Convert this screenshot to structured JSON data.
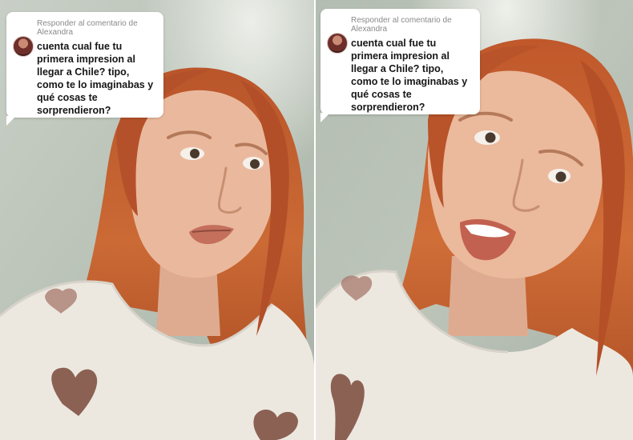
{
  "panels": [
    {
      "reply_label": "Responder al comentario de Alexandra",
      "question": "cuenta cual fue tu primera impresion al llegar a Chile? tipo, como te lo imaginabas y qué cosas te sorprendieron?"
    },
    {
      "reply_label": "Responder al comentario de Alexandra",
      "question": "cuenta cual fue tu primera impresion al llegar a Chile? tipo, como te lo imaginabas y qué cosas te sorprendieron?"
    }
  ],
  "colors": {
    "wall": "#b9c2b6",
    "hair": "#c6602f",
    "skin": "#e9b79b",
    "sweater": "#eeeae2",
    "heart": "#8a5f52"
  },
  "icons": [
    "commenter-avatar-icon"
  ]
}
